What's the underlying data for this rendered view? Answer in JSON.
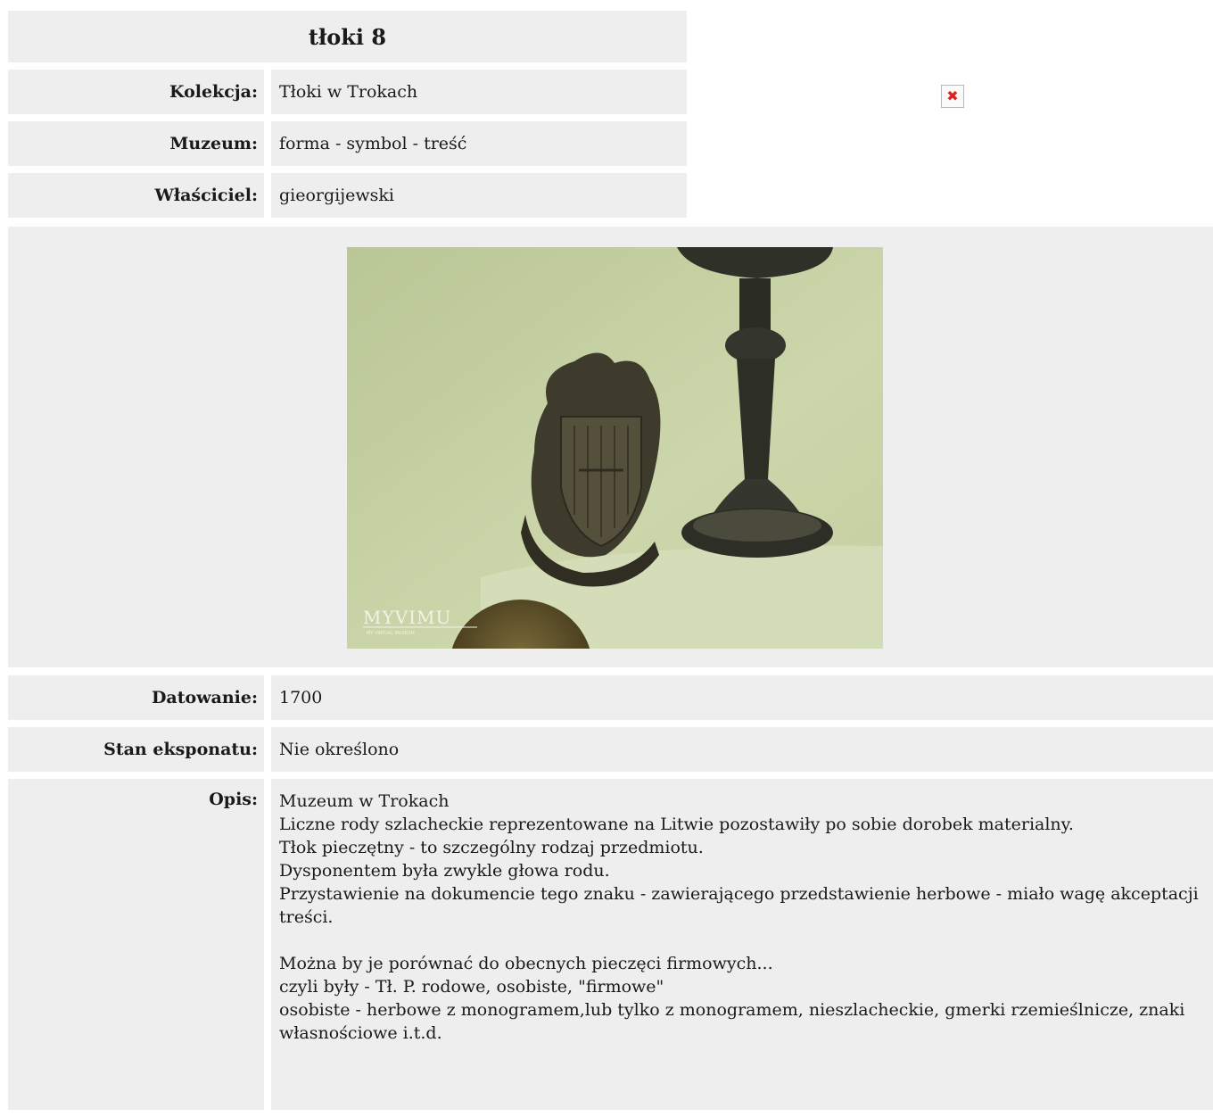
{
  "page_title": "tłoki 8",
  "meta": [
    {
      "label": "Kolekcja:",
      "value": "Tłoki w Trokach"
    },
    {
      "label": "Muzeum:",
      "value": "forma - symbol - treść"
    },
    {
      "label": "Właściciel:",
      "value": "gieorgijewski"
    }
  ],
  "broken_image_icon": "broken-image-icon",
  "photo": {
    "watermark": "MYVIMU",
    "watermark_sub": "MY VIRTUAL MUSEUM"
  },
  "details": {
    "dating_label": "Datowanie:",
    "dating_value": "1700",
    "condition_label": "Stan eksponatu:",
    "condition_value": "Nie określono",
    "description_label": "Opis:",
    "description_lines": [
      "Muzeum w Trokach",
      "Liczne rody szlacheckie reprezentowane na Litwie pozostawiły po sobie dorobek materialny.",
      "Tłok pieczętny - to szczególny rodzaj przedmiotu.",
      "Dysponentem była zwykle głowa rodu.",
      "Przystawienie na dokumencie tego znaku - zawierającego przedstawienie herbowe - miało wagę akceptacji treści.",
      "",
      "Można by je porównać do obecnych pieczęci firmowych...",
      "czyli były - Tł. P. rodowe, osobiste, \"firmowe\"",
      "osobiste - herbowe z monogramem,lub tylko z monogramem, nieszlacheckie, gmerki rzemieślnicze, znaki własnościowe i.t.d."
    ]
  }
}
